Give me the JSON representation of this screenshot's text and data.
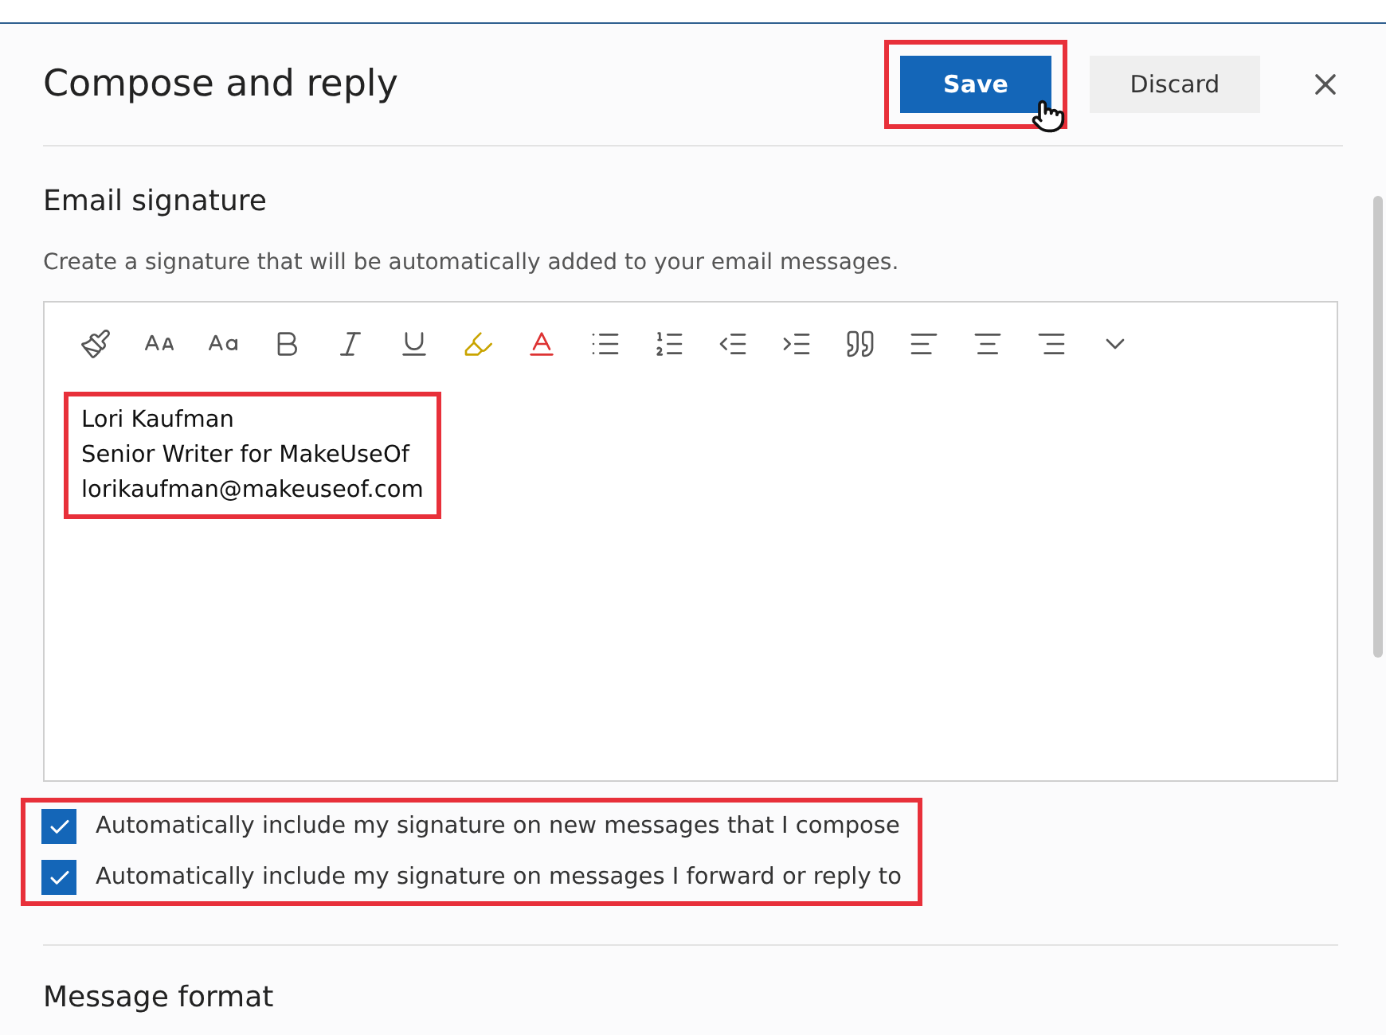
{
  "header": {
    "title": "Compose and reply",
    "buttons": [
      {
        "label": "Save",
        "kind": "primary"
      },
      {
        "label": "Discard",
        "kind": "secondary"
      }
    ]
  },
  "section": {
    "title": "Email signature",
    "description": "Create a signature that will be automatically added to your email messages."
  },
  "signature": {
    "lines": [
      "Lori Kaufman",
      "Senior Writer for MakeUseOf",
      "lorikaufman@makeuseof.com"
    ]
  },
  "options": [
    {
      "label": "Automatically include my signature on new messages that I compose",
      "checked": true
    },
    {
      "label": "Automatically include my signature on messages I forward or reply to",
      "checked": true
    }
  ],
  "next_section": {
    "title": "Message format"
  }
}
